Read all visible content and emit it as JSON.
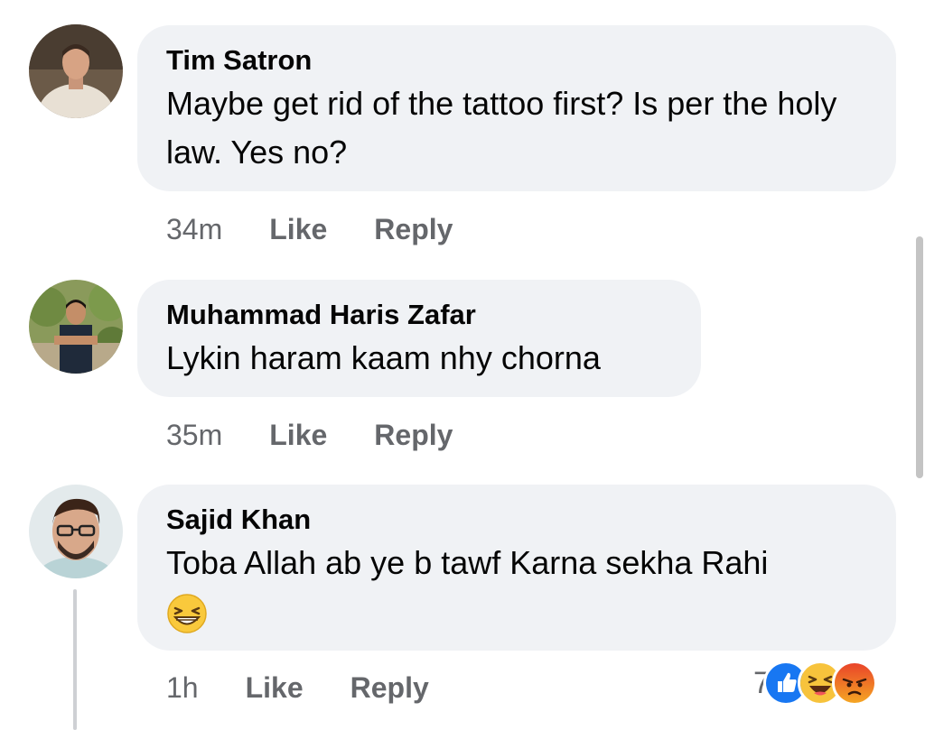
{
  "comments": [
    {
      "author": "Tim Satron",
      "text": "Maybe get rid of the tattoo first? Is per the holy law. Yes no?",
      "time": "34m",
      "like_label": "Like",
      "reply_label": "Reply"
    },
    {
      "author": "Muhammad Haris Zafar",
      "text": "Lykin haram kaam nhy chorna",
      "time": "35m",
      "like_label": "Like",
      "reply_label": "Reply"
    },
    {
      "author": "Sajid Khan",
      "text": "Toba Allah ab ye b tawf Karna sekha Rahi",
      "emoji": "grinning-squinting-emoji",
      "time": "1h",
      "like_label": "Like",
      "reply_label": "Reply",
      "reaction_count": "7",
      "reactions": [
        "like-reaction-icon",
        "haha-reaction-icon",
        "angry-reaction-icon"
      ]
    }
  ],
  "colors": {
    "bubble": "#f0f2f5",
    "meta_text": "#65676b",
    "like_blue": "#1877f2",
    "haha_yellow": "#f7c33c",
    "angry_orange": "#e9710f"
  }
}
